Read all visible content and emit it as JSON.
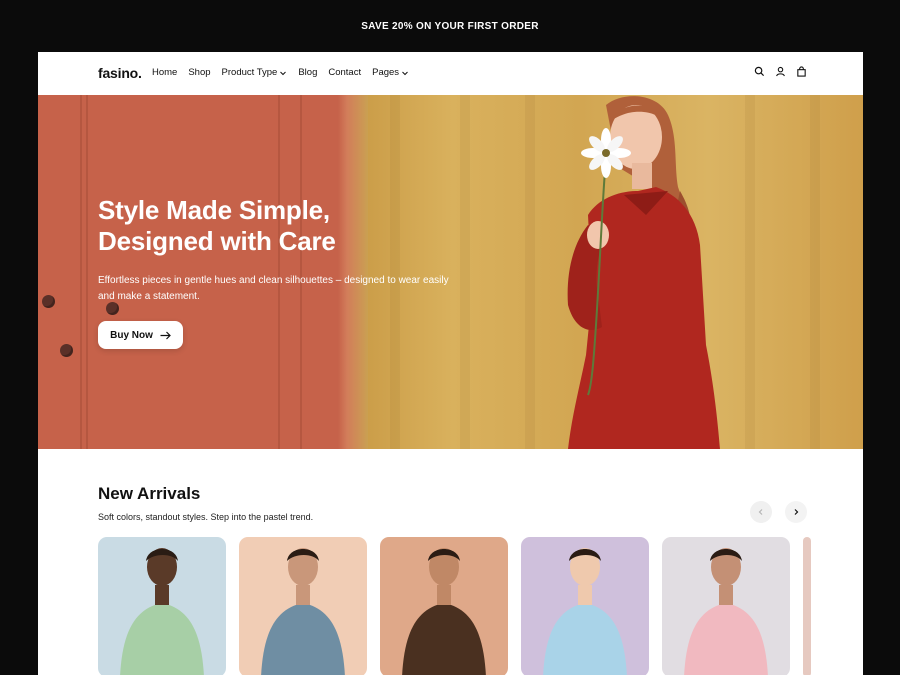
{
  "promo": {
    "text": "SAVE 20% ON YOUR FIRST ORDER"
  },
  "header": {
    "logo": "fasino.",
    "nav": [
      {
        "label": "Home",
        "has_dropdown": false
      },
      {
        "label": "Shop",
        "has_dropdown": false
      },
      {
        "label": "Product Type",
        "has_dropdown": true
      },
      {
        "label": "Blog",
        "has_dropdown": false
      },
      {
        "label": "Contact",
        "has_dropdown": false
      },
      {
        "label": "Pages",
        "has_dropdown": true
      }
    ],
    "icons": [
      "search-icon",
      "user-icon",
      "bag-icon"
    ]
  },
  "hero": {
    "title_line1": "Style Made Simple,",
    "title_line2": "Designed with Care",
    "subtitle_line1": "Effortless pieces in gentle hues and clean silhouettes – designed to wear easily",
    "subtitle_line2": "and make a statement.",
    "cta_label": "Buy Now"
  },
  "new_arrivals": {
    "title": "New Arrivals",
    "subtitle": "Soft colors, standout styles. Step into the pastel trend.",
    "products": [
      {
        "bg": "#c9dbe4",
        "garment": "#a7cfa6",
        "skin": "#5a3a28"
      },
      {
        "bg": "#f1cdb5",
        "garment": "#6f8ea3",
        "skin": "#c9977a"
      },
      {
        "bg": "#dfa889",
        "garment": "#4a3020",
        "skin": "#c08866"
      },
      {
        "bg": "#cfc0dc",
        "garment": "#a9d3e8",
        "skin": "#efc9ad"
      },
      {
        "bg": "#e1dde2",
        "garment": "#f1b9c0",
        "skin": "#c49075"
      }
    ]
  },
  "colors": {
    "door": "#c6624a",
    "curtain": "#d7ad55",
    "dress": "#b0271f",
    "frame_bg": "#0b0b0b"
  }
}
